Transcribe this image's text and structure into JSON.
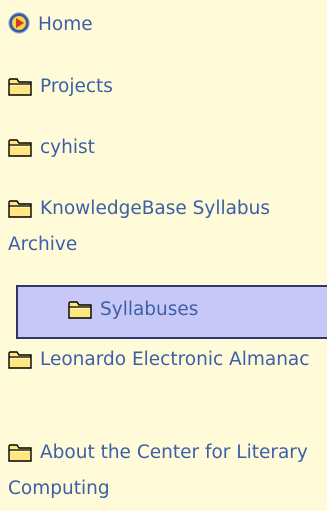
{
  "nav": {
    "items": [
      {
        "label": "Home",
        "icon": "home-globe-icon"
      },
      {
        "label": "Projects",
        "icon": "folder-icon"
      },
      {
        "label": "cyhist",
        "icon": "folder-icon"
      },
      {
        "label": "KnowledgeBase Syllabus Archive",
        "icon": "folder-icon"
      },
      {
        "label": "Syllabuses",
        "icon": "folder-icon",
        "selected": true
      },
      {
        "label": "Leonardo Electronic Almanac",
        "icon": "folder-icon"
      },
      {
        "label": "About the Center for Literary Computing",
        "icon": "folder-icon"
      }
    ]
  },
  "colors": {
    "background": "#fffbd8",
    "link": "#3b5fa8",
    "selected_bg": "#c8c8f8",
    "selected_border": "#31356f",
    "folder_fill": "#ffe680",
    "folder_stroke": "#000000"
  }
}
